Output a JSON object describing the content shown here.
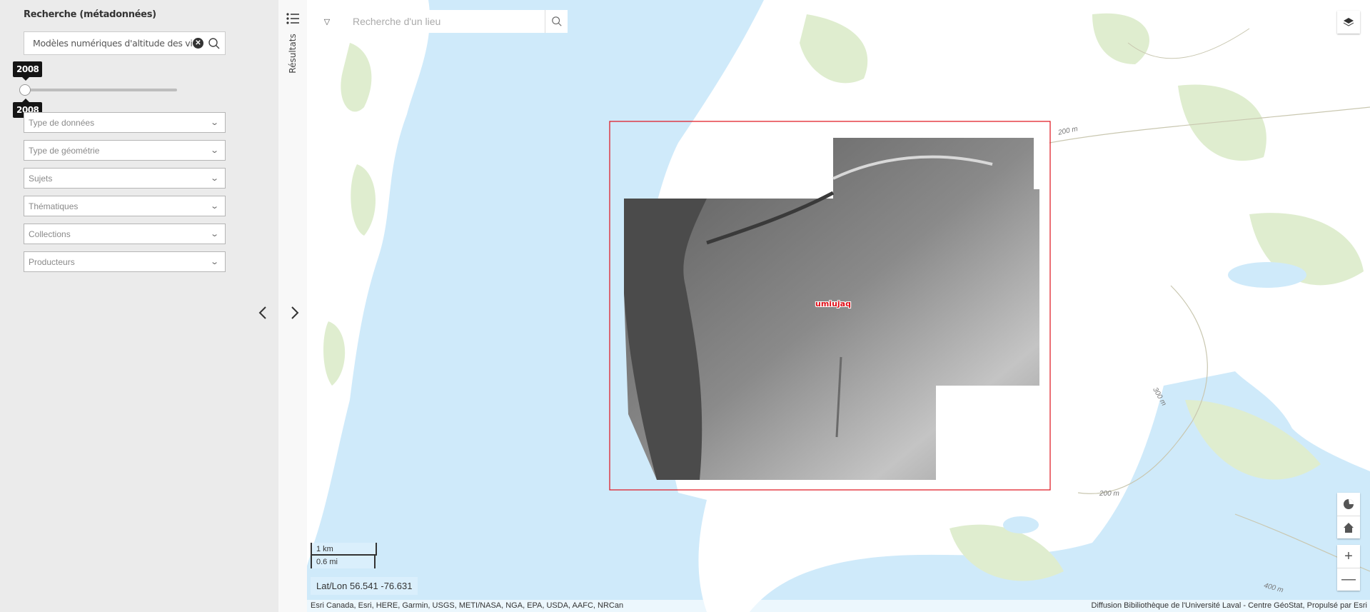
{
  "left_panel": {
    "title": "Recherche (métadonnées)",
    "search": {
      "value": "Modèles numériques d'altitude des vill",
      "clear_icon": "close-circle-icon",
      "search_icon": "search-icon"
    },
    "year_slider": {
      "min_label": "2008",
      "max_label": "2008",
      "value": 2008
    },
    "filters": [
      {
        "label": "Type de données"
      },
      {
        "label": "Type de géométrie"
      },
      {
        "label": "Sujets"
      },
      {
        "label": "Thématiques"
      },
      {
        "label": "Collections"
      },
      {
        "label": "Producteurs"
      }
    ],
    "pager": {
      "prev": "‹",
      "next": "›"
    }
  },
  "results_strip": {
    "label": "Résultats",
    "icon": "list-icon"
  },
  "map": {
    "geocoder": {
      "placeholder": "Recherche d'un lieu",
      "menu_icon": "triangle-down-icon",
      "search_icon": "search-icon"
    },
    "place_label": "umiujaq",
    "contour_labels": [
      "200 m",
      "300 m",
      "200 m",
      "400 m"
    ],
    "scalebar": {
      "metric": "1 km",
      "imperial": "0.6 mi"
    },
    "coordinates": "Lat/Lon 56.541 -76.631",
    "attribution_left": "Esri Canada, Esri, HERE, Garmin, USGS, METI/NASA, NGA, EPA, USDA, AAFC, NRCan",
    "attribution_right": "Diffusion Bibiliothèque de l'Université Laval - Centre GéoStat, Propulsé par Esri",
    "controls": {
      "layers": "layers-icon",
      "locate": "locate-icon",
      "home": "home-icon",
      "zoom_in": "+",
      "zoom_out": "—"
    },
    "colors": {
      "water": "#cfeafa",
      "land": "#ffffff",
      "vegetation": "#dfedcf",
      "extent_outline": "#e0101a"
    }
  }
}
